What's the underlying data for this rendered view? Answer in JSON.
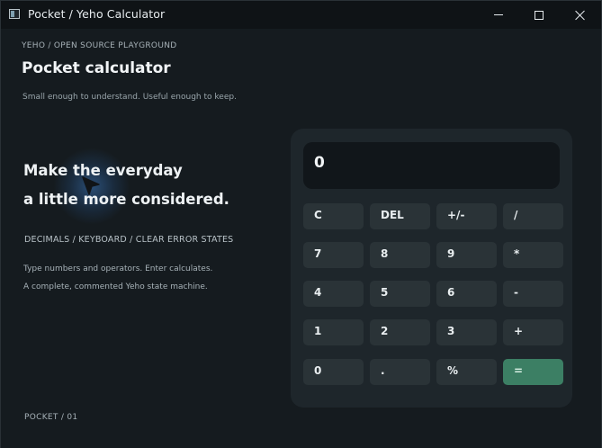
{
  "window": {
    "title": "Pocket / Yeho Calculator"
  },
  "header": {
    "eyebrow": "YEHO / OPEN SOURCE PLAYGROUND",
    "title": "Pocket calculator",
    "subtitle": "Small enough to understand. Useful enough to keep."
  },
  "hero": {
    "headline_line1": "Make the everyday",
    "headline_line2": "a little more considered.",
    "features": "DECIMALS / KEYBOARD / CLEAR ERROR STATES",
    "desc_line1": "Type numbers and operators. Enter calculates.",
    "desc_line2": "A complete, commented Yeho state machine."
  },
  "footer": {
    "label": "POCKET / 01"
  },
  "calculator": {
    "display": "0",
    "keys": [
      {
        "label": "C"
      },
      {
        "label": "DEL"
      },
      {
        "label": "+/-"
      },
      {
        "label": "/"
      },
      {
        "label": "7"
      },
      {
        "label": "8"
      },
      {
        "label": "9"
      },
      {
        "label": "*"
      },
      {
        "label": "4"
      },
      {
        "label": "5"
      },
      {
        "label": "6"
      },
      {
        "label": "-"
      },
      {
        "label": "1"
      },
      {
        "label": "2"
      },
      {
        "label": "3"
      },
      {
        "label": "+"
      },
      {
        "label": "0"
      },
      {
        "label": "."
      },
      {
        "label": "%"
      },
      {
        "label": "="
      }
    ]
  },
  "colors": {
    "background": "#151b1f",
    "panel": "#1e262b",
    "key": "#2a3337",
    "accent": "#3c7f64"
  },
  "icons": [
    "app-icon",
    "minimize-icon",
    "maximize-icon",
    "close-icon",
    "cursor-icon"
  ]
}
